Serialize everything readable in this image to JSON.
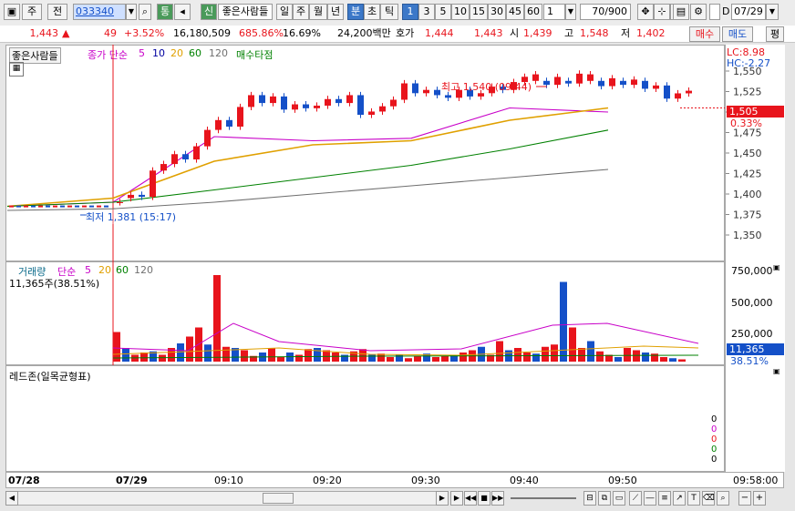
{
  "toolbar": {
    "market_code": "주",
    "market_all": "전",
    "stock_code": "033340",
    "stock_name": "좋은사람들",
    "btn_sync": "통",
    "btn_new": "신",
    "periods": [
      "일",
      "주",
      "월",
      "년",
      "분",
      "초",
      "틱"
    ],
    "active_period": "분",
    "minute_values": [
      "1",
      "3",
      "5",
      "10",
      "15",
      "30",
      "45",
      "60"
    ],
    "active_minute": "1",
    "interval_value": "1",
    "count": "70/900",
    "date": "07/29",
    "date_check": "D"
  },
  "quote": {
    "price": "1,443",
    "change": "49",
    "change_pct": "+3.52%",
    "volume": "16,180,509",
    "volume_ratio": "685.86%",
    "turnover": "16.69%",
    "amount": "24,200백만",
    "ask_label": "호가",
    "ask": "1,444",
    "bid": "1,443",
    "open_label": "시",
    "open": "1,439",
    "high_label": "고",
    "high": "1,548",
    "low_label": "저",
    "low": "1,402",
    "buy_label": "매수",
    "sell_label": "매도",
    "avg_label": "평"
  },
  "price_panel": {
    "name": "좋은사람들",
    "ma_label": "종가 단순",
    "ma_periods": [
      "5",
      "10",
      "20",
      "60",
      "120"
    ],
    "signal_label": "매수타점",
    "lc": "LC:8.98",
    "hc": "HC:-2.27",
    "high_annot": "최고 1,540 (09:44)",
    "low_annot": "최저 1,381 (15:17)",
    "current_price": "1,505",
    "current_pct": "0.33%",
    "yticks": [
      "1,550",
      "1,525",
      "1,500",
      "1,475",
      "1,450",
      "1,425",
      "1,400",
      "1,375",
      "1,350"
    ]
  },
  "volume_panel": {
    "label": "거래량",
    "ma_label": "단순",
    "ma_periods": [
      "5",
      "20",
      "60",
      "120"
    ],
    "info": "11,365주(38.51%)",
    "current": "11,365",
    "current_pct": "38.51%",
    "yticks": [
      "750,000",
      "500,000",
      "250,000"
    ]
  },
  "indicator_panel": {
    "label": "레드존(일목균형표)",
    "values": [
      "0",
      "0",
      "0",
      "0",
      "0"
    ]
  },
  "xaxis": {
    "labels": [
      "07/28",
      "07/29",
      "09:10",
      "09:20",
      "09:30",
      "09:40",
      "09:50",
      "09:58:00"
    ]
  },
  "colors": {
    "up": "#e8141c",
    "down": "#1450c8",
    "ma5": "#c800c8",
    "ma10": "#0000a0",
    "ma20": "#e0a000",
    "ma60": "#008000",
    "ma120": "#707070"
  },
  "chart_data": {
    "type": "line",
    "title": "",
    "x": [
      "07/28",
      "07/29",
      "09:10",
      "09:20",
      "09:30",
      "09:40",
      "09:50"
    ],
    "ylim": [
      1340,
      1560
    ],
    "series": [
      {
        "name": "5",
        "values": [
          1385,
          1390,
          1470,
          1465,
          1468,
          1505,
          1500
        ]
      },
      {
        "name": "20",
        "values": [
          1385,
          1395,
          1440,
          1460,
          1465,
          1490,
          1505
        ]
      },
      {
        "name": "60",
        "values": [
          1385,
          1390,
          1405,
          1420,
          1435,
          1455,
          1478
        ]
      },
      {
        "name": "120",
        "values": [
          1380,
          1382,
          1390,
          1400,
          1410,
          1420,
          1430
        ]
      }
    ]
  }
}
